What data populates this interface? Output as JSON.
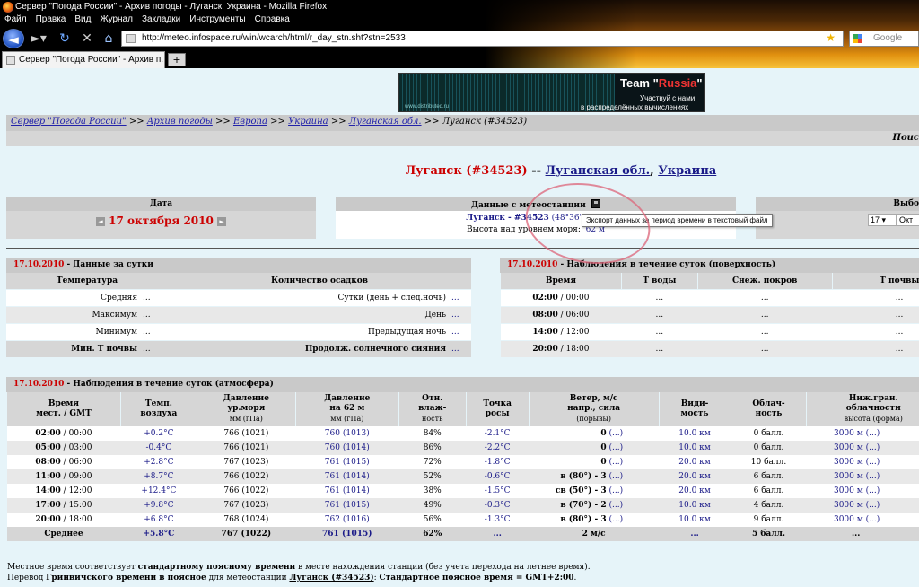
{
  "window": {
    "title": "Сервер \"Погода России\" - Архив погоды - Луганск, Украина - Mozilla Firefox",
    "menu": [
      "Файл",
      "Правка",
      "Вид",
      "Журнал",
      "Закладки",
      "Инструменты",
      "Справка"
    ],
    "url": "http://meteo.infospace.ru/win/wcarch/html/r_day_stn.sht?stn=2533",
    "search_placeholder": "Google",
    "tab_title": "Сервер \"Погода России\" - Архив п...",
    "new_tab": "+"
  },
  "banner": {
    "team_a": "Team \"",
    "team_b": "Russia",
    "team_c": "\"",
    "line1": "Участвуй с нами",
    "line2": "в распределённых вычислениях",
    "site": "www.distributed.ru"
  },
  "breadcrumb": {
    "items": [
      "Сервер \"Погода России\"",
      "Архив погоды",
      "Европа",
      "Украина",
      "Луганская обл."
    ],
    "sep": ">>",
    "current": "Луганск (#34523)"
  },
  "topbar_right": "Поис",
  "station": {
    "name": "Луганск (#34523)",
    "dash": "--",
    "region": "Луганская обл.",
    "country": "Украина"
  },
  "date_panel": {
    "header": "Дата",
    "value": "17 октября 2010",
    "prev": "◄",
    "next": "►"
  },
  "station_panel": {
    "header": "Данные с метеостанции",
    "station_link": "Луганск - #34523",
    "coords": "(48°36'N 39°",
    "altitude_label": "Высота над уровнем моря:",
    "altitude_value": "62 м",
    "tooltip": "Экспорт данных за период времени в текстовый файл"
  },
  "select_panel": {
    "header": "Выбо",
    "day": "17",
    "month": "Окт"
  },
  "daily": {
    "title_date": "17.10.2010",
    "title_text": " - Данные за сутки",
    "col1": "Температура",
    "col2": "Количество осадков",
    "rows": [
      {
        "l": "Средняя",
        "lv": "...",
        "r": "Сутки (день + след.ночь)",
        "rv": "..."
      },
      {
        "l": "Максимум",
        "lv": "...",
        "r": "День",
        "rv": "..."
      },
      {
        "l": "Минимум",
        "lv": "...",
        "r": "Предыдущая ночь",
        "rv": "..."
      },
      {
        "l": "Мин. Т почвы",
        "lv": "...",
        "r": "Продолж. солнечного сияния",
        "rv": "..."
      }
    ]
  },
  "surface": {
    "title_date": "17.10.2010",
    "title_text": " - Наблюдения в течение суток (поверхность)",
    "cols": [
      "Время",
      "Т воды",
      "Снеж. покров",
      "Т почвы"
    ],
    "rows": [
      {
        "t": "02:00",
        "g": "00:00",
        "v": [
          "...",
          "...",
          "..."
        ]
      },
      {
        "t": "08:00",
        "g": "06:00",
        "v": [
          "...",
          "...",
          "..."
        ]
      },
      {
        "t": "14:00",
        "g": "12:00",
        "v": [
          "...",
          "...",
          "..."
        ]
      },
      {
        "t": "20:00",
        "g": "18:00",
        "v": [
          "...",
          "...",
          "..."
        ]
      }
    ]
  },
  "atmosphere": {
    "title_date": "17.10.2010",
    "title_text": " - Наблюдения в течение суток (атмосфера)",
    "headers": [
      {
        "a": "Время",
        "b": "мест. / GMT",
        "c": ""
      },
      {
        "a": "Темп.",
        "b": "воздуха",
        "c": ""
      },
      {
        "a": "Давление",
        "b": "ур.моря",
        "c": "мм (гПа)"
      },
      {
        "a": "Давление",
        "b": "на 62 м",
        "c": "мм (гПа)"
      },
      {
        "a": "Отн.",
        "b": "влаж-",
        "c": "ность"
      },
      {
        "a": "Точка",
        "b": "росы",
        "c": ""
      },
      {
        "a": "Ветер, м/с",
        "b": "напр., сила",
        "c": "(порывы)"
      },
      {
        "a": "Види-",
        "b": "мость",
        "c": ""
      },
      {
        "a": "Облач-",
        "b": "ность",
        "c": ""
      },
      {
        "a": "Ниж.гран.",
        "b": "облачности",
        "c": "высота (форма)"
      }
    ],
    "rows": [
      {
        "t": "02:00",
        "g": "00:00",
        "temp": "+0.2°C",
        "p0": "766 (1021)",
        "p62": "760 (1013)",
        "hum": "84%",
        "dew": "-2.1°C",
        "wind": "0",
        "gust": "(...)",
        "vis": "10.0 км",
        "cloud": "0 балл.",
        "base": "3000 м",
        "form": "(...)"
      },
      {
        "t": "05:00",
        "g": "03:00",
        "temp": "-0.4°C",
        "p0": "766 (1021)",
        "p62": "760 (1014)",
        "hum": "86%",
        "dew": "-2.2°C",
        "wind": "0",
        "gust": "(...)",
        "vis": "10.0 км",
        "cloud": "0 балл.",
        "base": "3000 м",
        "form": "(...)"
      },
      {
        "t": "08:00",
        "g": "06:00",
        "temp": "+2.8°C",
        "p0": "767 (1023)",
        "p62": "761 (1015)",
        "hum": "72%",
        "dew": "-1.8°C",
        "wind": "0",
        "gust": "(...)",
        "vis": "20.0 км",
        "cloud": "10 балл.",
        "base": "3000 м",
        "form": "(...)"
      },
      {
        "t": "11:00",
        "g": "09:00",
        "temp": "+8.7°C",
        "p0": "766 (1022)",
        "p62": "761 (1014)",
        "hum": "52%",
        "dew": "-0.6°C",
        "wind": "в (80°) - 3",
        "gust": "(...)",
        "vis": "20.0 км",
        "cloud": "6 балл.",
        "base": "3000 м",
        "form": "(...)"
      },
      {
        "t": "14:00",
        "g": "12:00",
        "temp": "+12.4°C",
        "p0": "766 (1022)",
        "p62": "761 (1014)",
        "hum": "38%",
        "dew": "-1.5°C",
        "wind": "св (50°) - 3",
        "gust": "(...)",
        "vis": "20.0 км",
        "cloud": "6 балл.",
        "base": "3000 м",
        "form": "(...)"
      },
      {
        "t": "17:00",
        "g": "15:00",
        "temp": "+9.8°C",
        "p0": "767 (1023)",
        "p62": "761 (1015)",
        "hum": "49%",
        "dew": "-0.3°C",
        "wind": "в (70°) - 2",
        "gust": "(...)",
        "vis": "10.0 км",
        "cloud": "4 балл.",
        "base": "3000 м",
        "form": "(...)"
      },
      {
        "t": "20:00",
        "g": "18:00",
        "temp": "+6.8°C",
        "p0": "768 (1024)",
        "p62": "762 (1016)",
        "hum": "56%",
        "dew": "-1.3°C",
        "wind": "в (80°) - 3",
        "gust": "(...)",
        "vis": "10.0 км",
        "cloud": "9 балл.",
        "base": "3000 м",
        "form": "(...)"
      }
    ],
    "avg": {
      "label": "Среднее",
      "temp": "+5.8°C",
      "p0": "767 (1022)",
      "p62": "761 (1015)",
      "hum": "62%",
      "dew": "...",
      "wind": "2 м/с",
      "vis": "...",
      "cloud": "5 балл.",
      "base": "..."
    }
  },
  "notes": {
    "l1a": "Местное время соответствует ",
    "l1b": "стандартному поясному времени",
    "l1c": " в месте нахождения станции (без учета перехода на летнее время).",
    "l2a": "Перевод ",
    "l2b": "Гринвичского времени в поясное",
    "l2c": " для метеостанции ",
    "l2d": "Луганск (#34523)",
    "l2e": ": ",
    "l2f": "Стандартное поясное время = GMT+2:00",
    "l2g": "."
  }
}
